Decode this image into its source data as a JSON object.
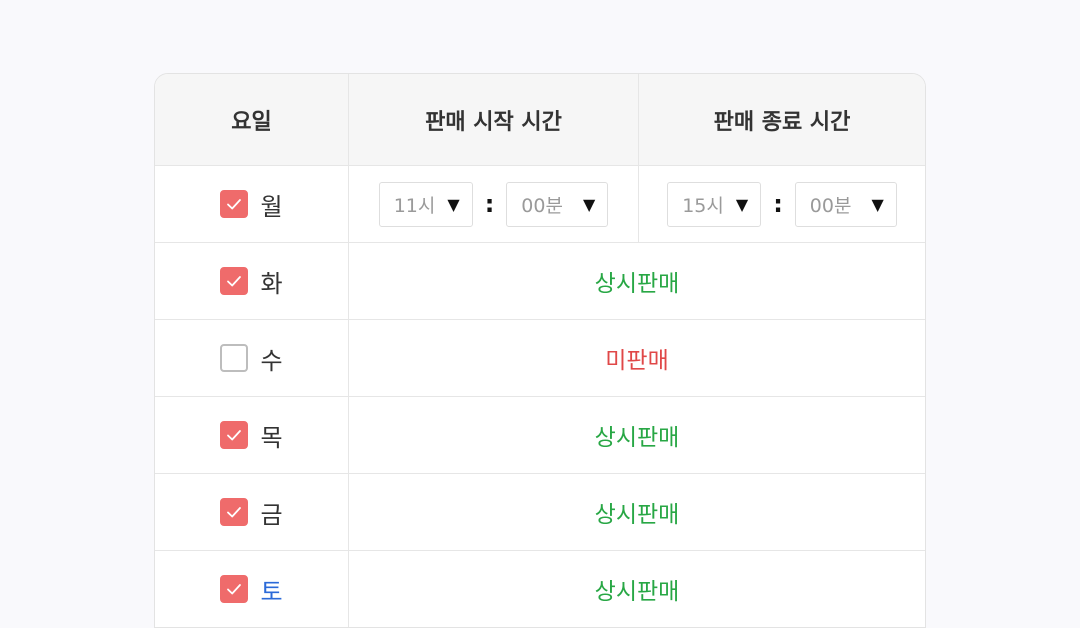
{
  "header": {
    "day": "요일",
    "start_time": "판매 시작 시간",
    "end_time": "판매 종료 시간"
  },
  "rows": [
    {
      "day": "월",
      "checked": true,
      "start_hour": "11시",
      "start_min": "00분",
      "end_hour": "15시",
      "end_min": "00분",
      "colon": ":"
    },
    {
      "day": "화",
      "checked": true,
      "status": "상시판매"
    },
    {
      "day": "수",
      "checked": false,
      "status": "미판매"
    },
    {
      "day": "목",
      "checked": true,
      "status": "상시판매"
    },
    {
      "day": "금",
      "checked": true,
      "status": "상시판매"
    },
    {
      "day": "토",
      "checked": true,
      "status": "상시판매"
    }
  ],
  "colors": {
    "checkbox_checked": "#ef6b6b",
    "status_on": "#28a745",
    "status_off": "#e04848",
    "saturday": "#2b6ad8"
  },
  "icons": {
    "checkbox": "check-icon",
    "dropdown": "caret-down-icon"
  }
}
